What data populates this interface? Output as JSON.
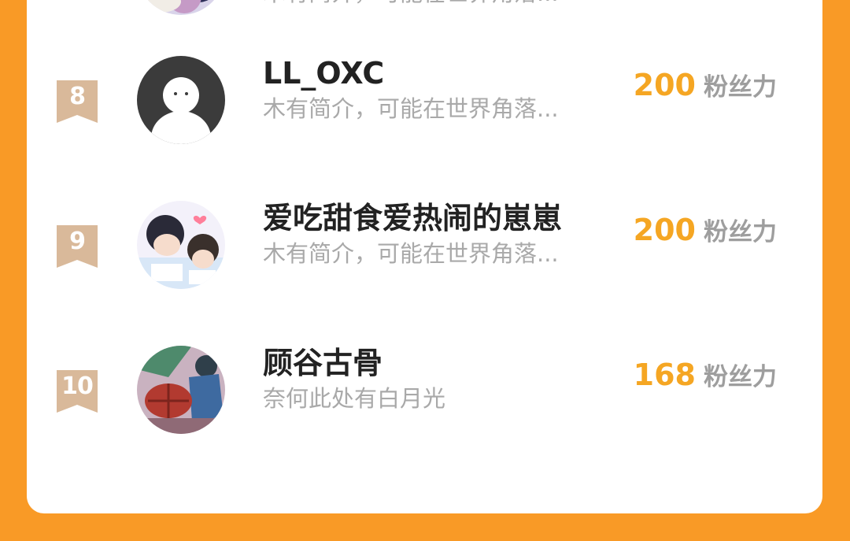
{
  "colors": {
    "background": "#f99a26",
    "card": "#ffffff",
    "rank_badge": "#d9b99a",
    "fans_number": "#f5a623",
    "bio_text": "#a9a9a9"
  },
  "ranking": [
    {
      "rank": "",
      "name": "",
      "bio": "木有简介，可能在世界角落...",
      "fans": "",
      "fans_label": "",
      "avatar_icon": "anime-avatar-icon"
    },
    {
      "rank": "8",
      "name": "LL_OXC",
      "bio": "木有简介，可能在世界角落...",
      "fans": "200",
      "fans_label": "粉丝力",
      "avatar_icon": "default-user-avatar-icon"
    },
    {
      "rank": "9",
      "name": "爱吃甜食爱热闹的崽崽",
      "bio": "木有简介，可能在世界角落...",
      "fans": "200",
      "fans_label": "粉丝力",
      "avatar_icon": "anime-couple-avatar-icon"
    },
    {
      "rank": "10",
      "name": "顾谷古骨",
      "bio": "奈何此处有白月光",
      "fans": "168",
      "fans_label": "粉丝力",
      "avatar_icon": "anime-umbrella-avatar-icon"
    }
  ]
}
